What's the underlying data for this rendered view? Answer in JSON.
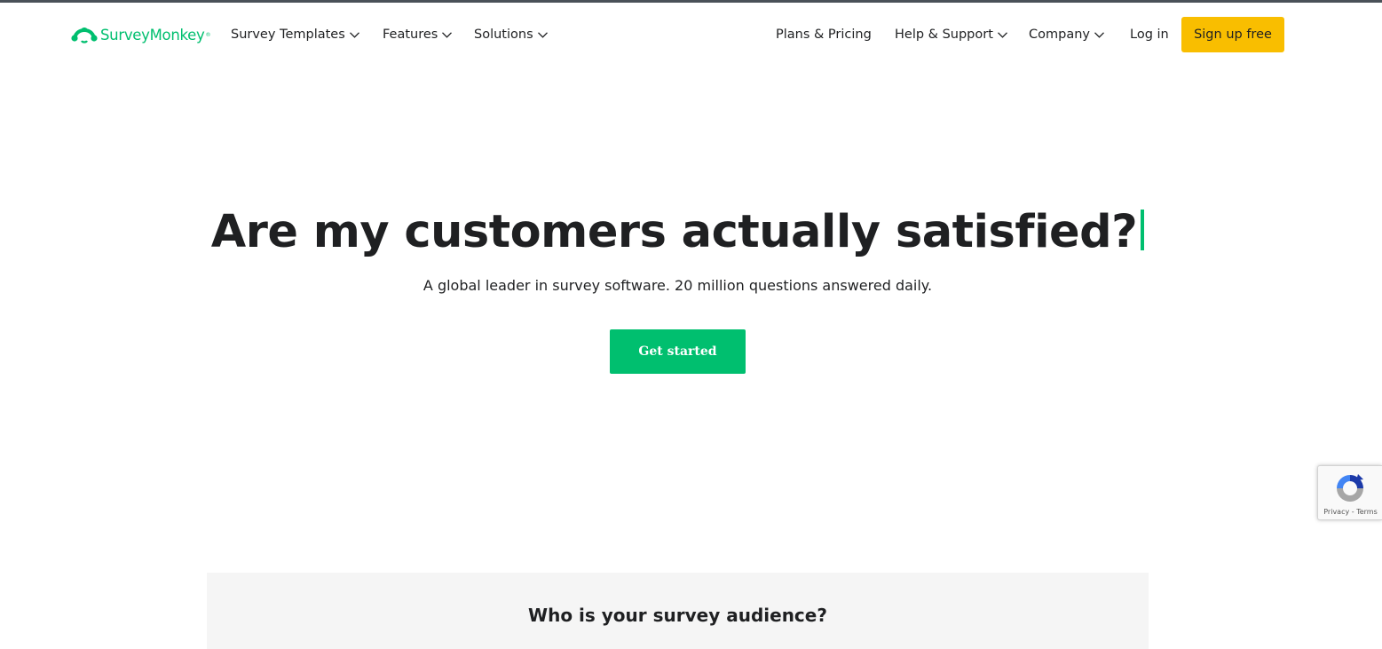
{
  "brand": {
    "name": "SurveyMonkey",
    "reg_mark": "®",
    "accent_color": "#00bf6f",
    "cta_color": "#f9be00"
  },
  "nav": {
    "left": [
      {
        "label": "Survey Templates",
        "has_dropdown": true
      },
      {
        "label": "Features",
        "has_dropdown": true
      },
      {
        "label": "Solutions",
        "has_dropdown": true
      }
    ],
    "right": [
      {
        "label": "Plans & Pricing",
        "has_dropdown": false
      },
      {
        "label": "Help & Support",
        "has_dropdown": true
      },
      {
        "label": "Company",
        "has_dropdown": true
      },
      {
        "label": "Log in",
        "has_dropdown": false
      }
    ],
    "signup_label": "Sign up free"
  },
  "hero": {
    "title": "Are my customers actually satisfied?",
    "subtitle": "A global leader in survey software. 20 million questions answered daily.",
    "cta_label": "Get started"
  },
  "audience": {
    "title": "Who is your survey audience?"
  },
  "recaptcha": {
    "links": "Privacy - Terms"
  },
  "icons": [
    "surveymonkey-logo-icon",
    "chevron-down-icon",
    "recaptcha-icon"
  ]
}
